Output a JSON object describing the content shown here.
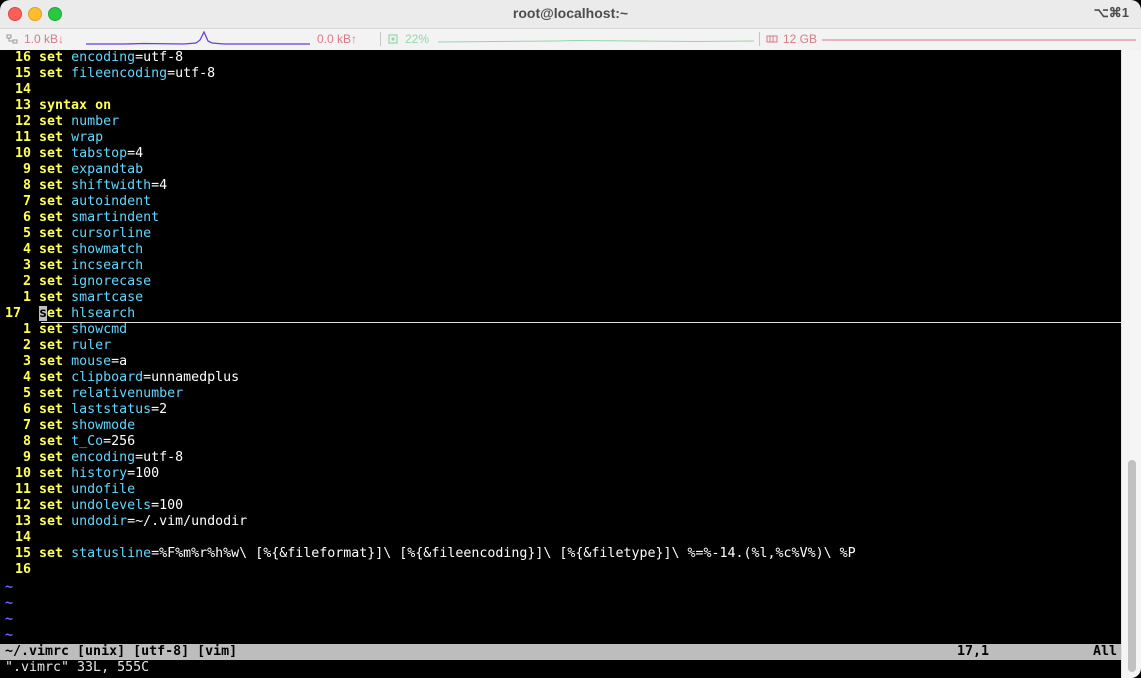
{
  "window": {
    "title": "root@localhost:~",
    "shortcut": "⌥⌘1"
  },
  "colors": {
    "net": "#d77a8a",
    "cpu": "#93d6a9",
    "line_numbers": "#ffff55",
    "keyword": "#ffff55",
    "option": "#5fd7ff",
    "tilde": "#6a6aff",
    "status_bg": "#bdbdbd"
  },
  "status": {
    "net_down": "1.0 kB↓",
    "net_up": "0.0 kB↑",
    "cpu": "22%",
    "mem": "12 GB",
    "icons": [
      "network-icon",
      "cpu-icon",
      "memory-icon"
    ]
  },
  "lines": [
    {
      "num": "16",
      "kw": "set",
      "opt": "encoding",
      "rest": "=utf-8"
    },
    {
      "num": "15",
      "kw": "set",
      "opt": "fileencoding",
      "rest": "=utf-8"
    },
    {
      "num": "14",
      "kw": "",
      "opt": "",
      "rest": ""
    },
    {
      "num": "13",
      "kw": "syntax",
      "opt": "on",
      "rest": "",
      "opt_kw": true
    },
    {
      "num": "12",
      "kw": "set",
      "opt": "number",
      "rest": ""
    },
    {
      "num": "11",
      "kw": "set",
      "opt": "wrap",
      "rest": ""
    },
    {
      "num": "10",
      "kw": "set",
      "opt": "tabstop",
      "rest": "=4"
    },
    {
      "num": "9",
      "kw": "set",
      "opt": "expandtab",
      "rest": ""
    },
    {
      "num": "8",
      "kw": "set",
      "opt": "shiftwidth",
      "rest": "=4"
    },
    {
      "num": "7",
      "kw": "set",
      "opt": "autoindent",
      "rest": ""
    },
    {
      "num": "6",
      "kw": "set",
      "opt": "smartindent",
      "rest": ""
    },
    {
      "num": "5",
      "kw": "set",
      "opt": "cursorline",
      "rest": ""
    },
    {
      "num": "4",
      "kw": "set",
      "opt": "showmatch",
      "rest": ""
    },
    {
      "num": "3",
      "kw": "set",
      "opt": "incsearch",
      "rest": ""
    },
    {
      "num": "2",
      "kw": "set",
      "opt": "ignorecase",
      "rest": ""
    },
    {
      "num": "1",
      "kw": "set",
      "opt": "smartcase",
      "rest": ""
    },
    {
      "num": "17",
      "kw": "set",
      "opt": "hlsearch",
      "rest": "",
      "current": true
    },
    {
      "num": "1",
      "kw": "set",
      "opt": "showcmd",
      "rest": ""
    },
    {
      "num": "2",
      "kw": "set",
      "opt": "ruler",
      "rest": ""
    },
    {
      "num": "3",
      "kw": "set",
      "opt": "mouse",
      "rest": "=a"
    },
    {
      "num": "4",
      "kw": "set",
      "opt": "clipboard",
      "rest": "=unnamedplus"
    },
    {
      "num": "5",
      "kw": "set",
      "opt": "relativenumber",
      "rest": ""
    },
    {
      "num": "6",
      "kw": "set",
      "opt": "laststatus",
      "rest": "=2"
    },
    {
      "num": "7",
      "kw": "set",
      "opt": "showmode",
      "rest": ""
    },
    {
      "num": "8",
      "kw": "set",
      "opt": "t_Co",
      "rest": "=256"
    },
    {
      "num": "9",
      "kw": "set",
      "opt": "encoding",
      "rest": "=utf-8"
    },
    {
      "num": "10",
      "kw": "set",
      "opt": "history",
      "rest": "=100"
    },
    {
      "num": "11",
      "kw": "set",
      "opt": "undofile",
      "rest": ""
    },
    {
      "num": "12",
      "kw": "set",
      "opt": "undolevels",
      "rest": "=100"
    },
    {
      "num": "13",
      "kw": "set",
      "opt": "undodir",
      "rest": "=~/.vim/undodir"
    },
    {
      "num": "14",
      "kw": "",
      "opt": "",
      "rest": ""
    },
    {
      "num": "15",
      "kw": "set",
      "opt": "statusline",
      "rest": "=%F%m%r%h%w\\ [%{&fileformat}]\\ [%{&fileencoding}]\\ [%{&filetype}]\\ %=%-14.(%l,%c%V%)\\ %P"
    },
    {
      "num": "16",
      "kw": "",
      "opt": "",
      "rest": ""
    }
  ],
  "tildes": [
    "~",
    "~",
    "~",
    "~"
  ],
  "vim_status": {
    "left": "~/.vimrc [unix] [utf-8] [vim]",
    "position": "17,1",
    "percent": "All"
  },
  "message": "\".vimrc\" 33L, 555C"
}
